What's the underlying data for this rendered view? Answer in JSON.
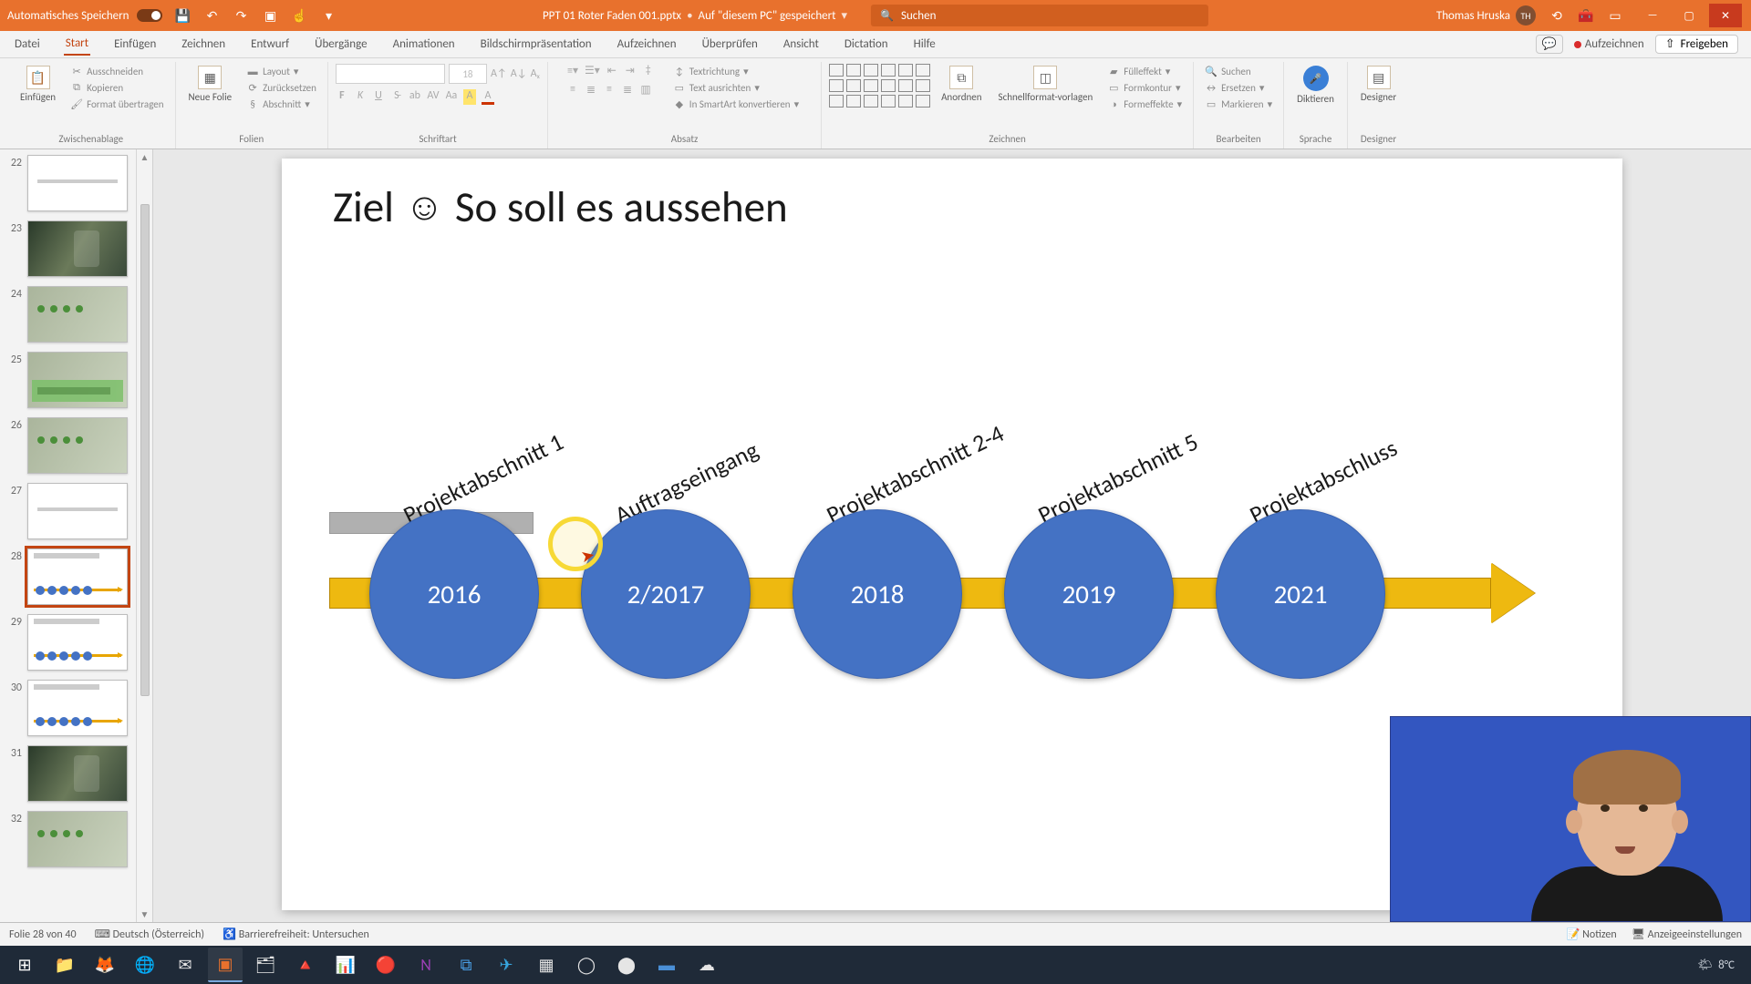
{
  "titlebar": {
    "autosave": "Automatisches Speichern",
    "filename": "PPT 01 Roter Faden 001.pptx",
    "save_location": "Auf \"diesem PC\" gespeichert",
    "search_placeholder": "Suchen",
    "user_name": "Thomas Hruska",
    "user_initials": "TH"
  },
  "tabs": {
    "items": [
      "Datei",
      "Start",
      "Einfügen",
      "Zeichnen",
      "Entwurf",
      "Übergänge",
      "Animationen",
      "Bildschirmpräsentation",
      "Aufzeichnen",
      "Überprüfen",
      "Ansicht",
      "Dictation",
      "Hilfe"
    ],
    "record": "Aufzeichnen",
    "share": "Freigeben"
  },
  "ribbon": {
    "clipboard": {
      "paste": "Einfügen",
      "cut": "Ausschneiden",
      "copy": "Kopieren",
      "format_painter": "Format übertragen",
      "label": "Zwischenablage"
    },
    "slides": {
      "new_slide": "Neue Folie",
      "layout": "Layout",
      "reset": "Zurücksetzen",
      "section": "Abschnitt",
      "label": "Folien"
    },
    "font": {
      "size": "18",
      "label": "Schriftart"
    },
    "paragraph": {
      "text_direction": "Textrichtung",
      "align_text": "Text ausrichten",
      "convert_smartart": "In SmartArt konvertieren",
      "label": "Absatz"
    },
    "drawing": {
      "arrange": "Anordnen",
      "quick_styles": "Schnellformat-vorlagen",
      "fill": "Fülleffekt",
      "outline": "Formkontur",
      "effects": "Formeffekte",
      "label": "Zeichnen"
    },
    "editing": {
      "find": "Suchen",
      "replace": "Ersetzen",
      "select": "Markieren",
      "label": "Bearbeiten"
    },
    "voice": {
      "dictate": "Diktieren",
      "label": "Sprache"
    },
    "designer": {
      "btn": "Designer",
      "label": "Designer"
    }
  },
  "thumbnails": {
    "start": 22,
    "count": 11,
    "selected": 28
  },
  "slide": {
    "title_pre": "Ziel",
    "title_post": "So soll es aussehen",
    "labels": [
      "Projektabschnitt 1",
      "Auftragseingang",
      "Projektabschnitt 2-4",
      "Projektabschnitt 5",
      "Projektabschluss"
    ],
    "years": [
      "2016",
      "2/2017",
      "2018",
      "2019",
      "2021"
    ]
  },
  "statusbar": {
    "slide_counter": "Folie 28 von 40",
    "language": "Deutsch (Österreich)",
    "accessibility": "Barrierefreiheit: Untersuchen",
    "notes": "Notizen",
    "display_settings": "Anzeigeeinstellungen"
  },
  "taskbar": {
    "temp": "8°C"
  }
}
